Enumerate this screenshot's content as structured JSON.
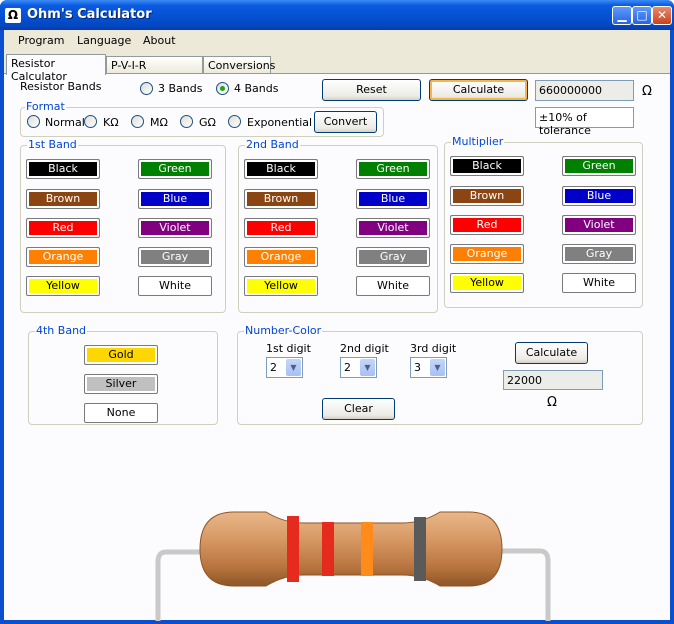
{
  "window": {
    "title": "Ohm's Calculator",
    "icon_glyph": "Ω",
    "min": "▁",
    "max": "□",
    "close": "✕"
  },
  "menu": [
    "Program",
    "Language",
    "About"
  ],
  "tabs": [
    "Resistor Calculator",
    "P-V-I-R Calculator",
    "Conversions"
  ],
  "bands_selector": {
    "label": "Resistor Bands",
    "options": [
      "3 Bands",
      "4 Bands"
    ],
    "selected": "4 Bands"
  },
  "buttons": {
    "reset": "Reset",
    "calculate": "Calculate",
    "convert": "Convert",
    "clear": "Clear",
    "nc_calculate": "Calculate"
  },
  "result": {
    "value": "660000000",
    "unit": "Ω",
    "tolerance": "±10% of tolerance"
  },
  "format": {
    "legend": "Format",
    "options": [
      "Normal",
      "KΩ",
      "MΩ",
      "GΩ",
      "Exponential"
    ]
  },
  "band_groups": {
    "band1": "1st Band",
    "band2": "2nd Band",
    "multiplier": "Multiplier",
    "band4": "4th Band"
  },
  "colors": [
    {
      "name": "Black",
      "bg": "#000000",
      "fg": "#ffffff"
    },
    {
      "name": "Green",
      "bg": "#008000",
      "fg": "#ffffff"
    },
    {
      "name": "Brown",
      "bg": "#8b4513",
      "fg": "#ffffff"
    },
    {
      "name": "Blue",
      "bg": "#0000c8",
      "fg": "#ffffff"
    },
    {
      "name": "Red",
      "bg": "#ff0000",
      "fg": "#ffffff"
    },
    {
      "name": "Violet",
      "bg": "#800080",
      "fg": "#ffffff"
    },
    {
      "name": "Orange",
      "bg": "#ff8000",
      "fg": "#ffffff"
    },
    {
      "name": "Gray",
      "bg": "#808080",
      "fg": "#ffffff"
    },
    {
      "name": "Yellow",
      "bg": "#ffff00",
      "fg": "#000000"
    },
    {
      "name": "White",
      "bg": "#ffffff",
      "fg": "#000000"
    }
  ],
  "tolerance_colors": [
    {
      "name": "Gold",
      "bg": "#ffd700",
      "fg": "#000000"
    },
    {
      "name": "Silver",
      "bg": "#c0c0c0",
      "fg": "#000000"
    },
    {
      "name": "None",
      "bg": "#ffffff",
      "fg": "#000000"
    }
  ],
  "number_color": {
    "legend": "Number-Color",
    "digit_labels": [
      "1st digit",
      "2nd digit",
      "3rd digit"
    ],
    "digit_values": [
      "2",
      "2",
      "3"
    ],
    "result": "22000",
    "unit": "Ω"
  },
  "resistor_stripes": [
    "#e52a1e",
    "#e52a1e",
    "#ff8c1a",
    "#5a5a5a"
  ]
}
